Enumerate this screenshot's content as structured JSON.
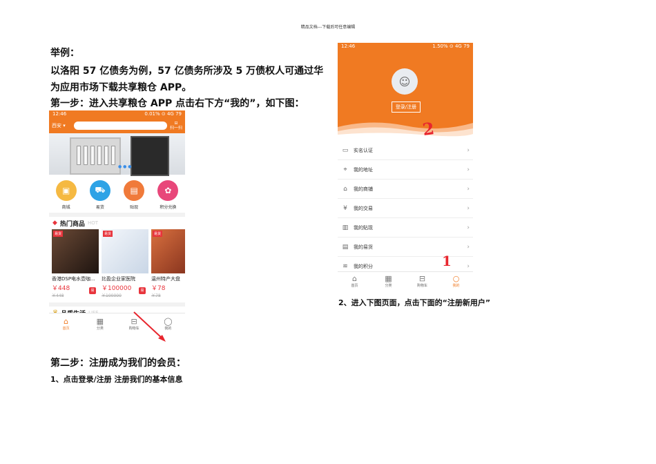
{
  "header_note": "精品文档---下载后可任意编辑",
  "text": {
    "example_title": "举例：",
    "example_line1": "以洛阳 57 亿债务为例，57 亿债务所涉及 5 万债权人可通过华",
    "example_line2": "为应用市场下载共享粮仓 APP。",
    "step1": "第一步：进入共享粮仓 APP 点击右下方“我的”，如下图：",
    "step2": "第二步：注册成为我们的会员：",
    "step2_item1": "1、点击登录/注册  注册我们的基本信息",
    "step2_item2": "2、进入下图页面，点击下面的“注册新用户”"
  },
  "phone1": {
    "status_time": "12:46",
    "status_right": "0.01% ⊙ 4G 79",
    "city": "西安",
    "scan_label": "扫一扫",
    "icons": [
      {
        "label": "商城",
        "color": "#f5b942",
        "glyph": "▣"
      },
      {
        "label": "易货",
        "color": "#2ea3e6",
        "glyph": "⛟"
      },
      {
        "label": "贴现",
        "color": "#f07a3a",
        "glyph": "▤"
      },
      {
        "label": "积分兑换",
        "color": "#e8477a",
        "glyph": "✿"
      }
    ],
    "hot_title": "热门商品",
    "hot_en": "HOT",
    "products": [
      {
        "tag": "易货",
        "name": "香港DSP电水壶咖...",
        "price": "￥448",
        "old": "￥448",
        "img_color": "#3b2a22"
      },
      {
        "tag": "易货",
        "name": "比盈企业家医院",
        "price": "￥100000",
        "old": "￥100000",
        "img_color": "#e9eef5"
      },
      {
        "tag": "易货",
        "name": "温州特产大盘",
        "price": "￥78",
        "old": "￥78",
        "img_color": "#c9653f"
      }
    ],
    "sticker": "易",
    "quality_title": "品质生活",
    "quality_en": "LIFE",
    "tabs": [
      {
        "label": "首页",
        "glyph": "⌂",
        "active": true
      },
      {
        "label": "分类",
        "glyph": "▦",
        "active": false
      },
      {
        "label": "购物车",
        "glyph": "⊟",
        "active": false
      },
      {
        "label": "我的",
        "glyph": "◯",
        "active": false
      }
    ]
  },
  "phone2": {
    "status_time": "12:46",
    "status_right": "1.50% ⊙ 4G 79",
    "login_button": "登录/注册",
    "menu": [
      {
        "label": "实名认证",
        "glyph": "▭"
      },
      {
        "label": "我的地址",
        "glyph": "⌖"
      },
      {
        "label": "我的商铺",
        "glyph": "⌂"
      },
      {
        "label": "我的交易",
        "glyph": "¥"
      },
      {
        "label": "我的贴现",
        "glyph": "▥"
      },
      {
        "label": "我的易货",
        "glyph": "▤"
      },
      {
        "label": "我的积分",
        "glyph": "≋"
      }
    ],
    "tabs": [
      {
        "label": "首页",
        "glyph": "⌂",
        "active": false
      },
      {
        "label": "分类",
        "glyph": "▦",
        "active": false
      },
      {
        "label": "购物车",
        "glyph": "⊟",
        "active": false
      },
      {
        "label": "我的",
        "glyph": "○",
        "active": true
      }
    ]
  },
  "annotations": {
    "num1": "1",
    "num2": "2",
    "color": "#e8262e"
  }
}
